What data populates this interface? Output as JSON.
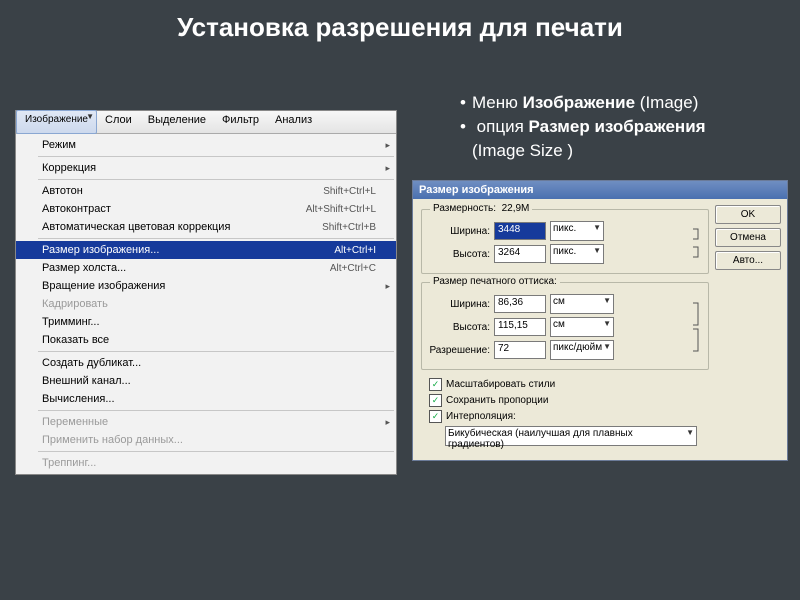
{
  "title": "Установка разрешения для печати",
  "bullets": {
    "b1a": "Меню ",
    "b1b": "Изображение",
    "b1c": " (Image)",
    "b2a": " опция ",
    "b2b": "Размер изображения",
    "b2c": "",
    "b2d": "  (Image Size )"
  },
  "menubar": {
    "m0": "Изображение",
    "m1": "Слои",
    "m2": "Выделение",
    "m3": "Фильтр",
    "m4": "Анализ"
  },
  "menu": {
    "mode": "Режим",
    "adj": "Коррекция",
    "autotone": "Автотон",
    "autotone_sc": "Shift+Ctrl+L",
    "autocontrast": "Автоконтраст",
    "autocontrast_sc": "Alt+Shift+Ctrl+L",
    "autocolor": "Автоматическая цветовая коррекция",
    "autocolor_sc": "Shift+Ctrl+B",
    "imagesize": "Размер изображения...",
    "imagesize_sc": "Alt+Ctrl+I",
    "canvassize": "Размер холста...",
    "canvassize_sc": "Alt+Ctrl+C",
    "rotate": "Вращение изображения",
    "crop": "Кадрировать",
    "trim": "Тримминг...",
    "reveal": "Показать все",
    "dup": "Создать дубликат...",
    "apply": "Внешний канал...",
    "calc": "Вычисления...",
    "vars": "Переменные",
    "applyds": "Применить набор данных...",
    "trap": "Треппинг..."
  },
  "dlg": {
    "title": "Размер изображения",
    "ok": "OK",
    "cancel": "Отмена",
    "auto": "Авто...",
    "pixdim_leg": "Размерность:",
    "pixdim_val": "22,9М",
    "width_l": "Ширина:",
    "width_v": "3448",
    "width_u": "пикс.",
    "height_l": "Высота:",
    "height_v": "3264",
    "height_u": "пикс.",
    "doc_leg": "Размер печатного оттиска:",
    "dwidth_l": "Ширина:",
    "dwidth_v": "86,36",
    "dwidth_u": "см",
    "dheight_l": "Высота:",
    "dheight_v": "115,15",
    "dheight_u": "см",
    "res_l": "Разрешение:",
    "res_v": "72",
    "res_u": "пикс/дюйм",
    "chk1": "Масштабировать стили",
    "chk2": "Сохранить пропорции",
    "chk3": "Интерполяция:",
    "method": "Бикубическая (наилучшая для плавных градиентов)"
  }
}
